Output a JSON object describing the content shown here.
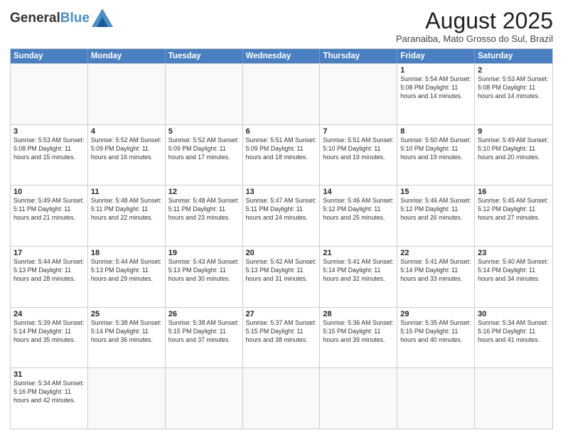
{
  "header": {
    "logo_general": "General",
    "logo_blue": "Blue",
    "title": "August 2025",
    "subtitle": "Paranaiba, Mato Grosso do Sul, Brazil"
  },
  "weekdays": [
    "Sunday",
    "Monday",
    "Tuesday",
    "Wednesday",
    "Thursday",
    "Friday",
    "Saturday"
  ],
  "weeks": [
    [
      {
        "day": "",
        "info": ""
      },
      {
        "day": "",
        "info": ""
      },
      {
        "day": "",
        "info": ""
      },
      {
        "day": "",
        "info": ""
      },
      {
        "day": "",
        "info": ""
      },
      {
        "day": "1",
        "info": "Sunrise: 5:54 AM\nSunset: 5:08 PM\nDaylight: 11 hours and 14 minutes."
      },
      {
        "day": "2",
        "info": "Sunrise: 5:53 AM\nSunset: 5:08 PM\nDaylight: 11 hours and 14 minutes."
      }
    ],
    [
      {
        "day": "3",
        "info": "Sunrise: 5:53 AM\nSunset: 5:08 PM\nDaylight: 11 hours and 15 minutes."
      },
      {
        "day": "4",
        "info": "Sunrise: 5:52 AM\nSunset: 5:09 PM\nDaylight: 11 hours and 16 minutes."
      },
      {
        "day": "5",
        "info": "Sunrise: 5:52 AM\nSunset: 5:09 PM\nDaylight: 11 hours and 17 minutes."
      },
      {
        "day": "6",
        "info": "Sunrise: 5:51 AM\nSunset: 5:09 PM\nDaylight: 11 hours and 18 minutes."
      },
      {
        "day": "7",
        "info": "Sunrise: 5:51 AM\nSunset: 5:10 PM\nDaylight: 11 hours and 19 minutes."
      },
      {
        "day": "8",
        "info": "Sunrise: 5:50 AM\nSunset: 5:10 PM\nDaylight: 11 hours and 19 minutes."
      },
      {
        "day": "9",
        "info": "Sunrise: 5:49 AM\nSunset: 5:10 PM\nDaylight: 11 hours and 20 minutes."
      }
    ],
    [
      {
        "day": "10",
        "info": "Sunrise: 5:49 AM\nSunset: 5:11 PM\nDaylight: 11 hours and 21 minutes."
      },
      {
        "day": "11",
        "info": "Sunrise: 5:48 AM\nSunset: 5:11 PM\nDaylight: 11 hours and 22 minutes."
      },
      {
        "day": "12",
        "info": "Sunrise: 5:48 AM\nSunset: 5:11 PM\nDaylight: 11 hours and 23 minutes."
      },
      {
        "day": "13",
        "info": "Sunrise: 5:47 AM\nSunset: 5:11 PM\nDaylight: 11 hours and 24 minutes."
      },
      {
        "day": "14",
        "info": "Sunrise: 5:46 AM\nSunset: 5:12 PM\nDaylight: 11 hours and 25 minutes."
      },
      {
        "day": "15",
        "info": "Sunrise: 5:46 AM\nSunset: 5:12 PM\nDaylight: 11 hours and 26 minutes."
      },
      {
        "day": "16",
        "info": "Sunrise: 5:45 AM\nSunset: 5:12 PM\nDaylight: 11 hours and 27 minutes."
      }
    ],
    [
      {
        "day": "17",
        "info": "Sunrise: 5:44 AM\nSunset: 5:13 PM\nDaylight: 11 hours and 28 minutes."
      },
      {
        "day": "18",
        "info": "Sunrise: 5:44 AM\nSunset: 5:13 PM\nDaylight: 11 hours and 29 minutes."
      },
      {
        "day": "19",
        "info": "Sunrise: 5:43 AM\nSunset: 5:13 PM\nDaylight: 11 hours and 30 minutes."
      },
      {
        "day": "20",
        "info": "Sunrise: 5:42 AM\nSunset: 5:13 PM\nDaylight: 11 hours and 31 minutes."
      },
      {
        "day": "21",
        "info": "Sunrise: 5:41 AM\nSunset: 5:14 PM\nDaylight: 11 hours and 32 minutes."
      },
      {
        "day": "22",
        "info": "Sunrise: 5:41 AM\nSunset: 5:14 PM\nDaylight: 11 hours and 33 minutes."
      },
      {
        "day": "23",
        "info": "Sunrise: 5:40 AM\nSunset: 5:14 PM\nDaylight: 11 hours and 34 minutes."
      }
    ],
    [
      {
        "day": "24",
        "info": "Sunrise: 5:39 AM\nSunset: 5:14 PM\nDaylight: 11 hours and 35 minutes."
      },
      {
        "day": "25",
        "info": "Sunrise: 5:38 AM\nSunset: 5:14 PM\nDaylight: 11 hours and 36 minutes."
      },
      {
        "day": "26",
        "info": "Sunrise: 5:38 AM\nSunset: 5:15 PM\nDaylight: 11 hours and 37 minutes."
      },
      {
        "day": "27",
        "info": "Sunrise: 5:37 AM\nSunset: 5:15 PM\nDaylight: 11 hours and 38 minutes."
      },
      {
        "day": "28",
        "info": "Sunrise: 5:36 AM\nSunset: 5:15 PM\nDaylight: 11 hours and 39 minutes."
      },
      {
        "day": "29",
        "info": "Sunrise: 5:35 AM\nSunset: 5:15 PM\nDaylight: 11 hours and 40 minutes."
      },
      {
        "day": "30",
        "info": "Sunrise: 5:34 AM\nSunset: 5:16 PM\nDaylight: 11 hours and 41 minutes."
      }
    ],
    [
      {
        "day": "31",
        "info": "Sunrise: 5:34 AM\nSunset: 5:16 PM\nDaylight: 11 hours and 42 minutes."
      },
      {
        "day": "",
        "info": ""
      },
      {
        "day": "",
        "info": ""
      },
      {
        "day": "",
        "info": ""
      },
      {
        "day": "",
        "info": ""
      },
      {
        "day": "",
        "info": ""
      },
      {
        "day": "",
        "info": ""
      }
    ]
  ]
}
